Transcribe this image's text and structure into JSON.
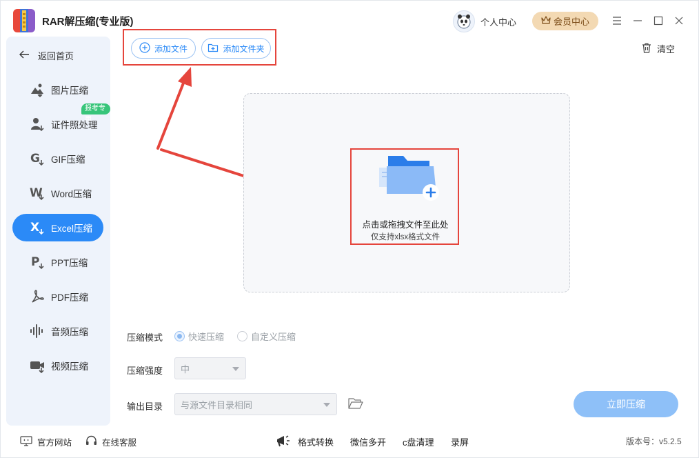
{
  "app": {
    "title": "RAR解压缩(专业版)"
  },
  "header": {
    "profile_label": "个人中心",
    "vip_label": "会员中心"
  },
  "sidebar": {
    "back_label": "返回首页",
    "badge": "报考专用",
    "items": [
      {
        "label": "图片压缩",
        "icon": "image-compress-icon"
      },
      {
        "label": "证件照处理",
        "icon": "id-photo-icon"
      },
      {
        "label": "GIF压缩",
        "icon": "gif-icon"
      },
      {
        "label": "Word压缩",
        "icon": "word-icon"
      },
      {
        "label": "Excel压缩",
        "icon": "excel-icon",
        "active": true
      },
      {
        "label": "PPT压缩",
        "icon": "ppt-icon"
      },
      {
        "label": "PDF压缩",
        "icon": "pdf-icon"
      },
      {
        "label": "音频压缩",
        "icon": "audio-icon"
      },
      {
        "label": "视频压缩",
        "icon": "video-icon"
      }
    ]
  },
  "toolbar": {
    "add_file": "添加文件",
    "add_folder": "添加文件夹",
    "clear": "清空"
  },
  "dropzone": {
    "main_text": "点击或拖拽文件至此处",
    "sub_text": "仅支持xlsx格式文件"
  },
  "settings": {
    "mode_label": "压缩模式",
    "mode_options": [
      "快速压缩",
      "自定义压缩"
    ],
    "mode_selected": "快速压缩",
    "strength_label": "压缩强度",
    "strength_value": "中",
    "output_label": "输出目录",
    "output_value": "与源文件目录相同",
    "start_button": "立即压缩"
  },
  "footer": {
    "website": "官方网站",
    "support": "在线客服",
    "links": [
      "格式转换",
      "微信多开",
      "c盘清理",
      "录屏"
    ],
    "version": "版本号：v5.2.5"
  },
  "colors": {
    "accent": "#2b8af7",
    "highlight": "#e5453c",
    "vip": "#f3d9b3",
    "sidebar_bg": "#eef3fb"
  }
}
